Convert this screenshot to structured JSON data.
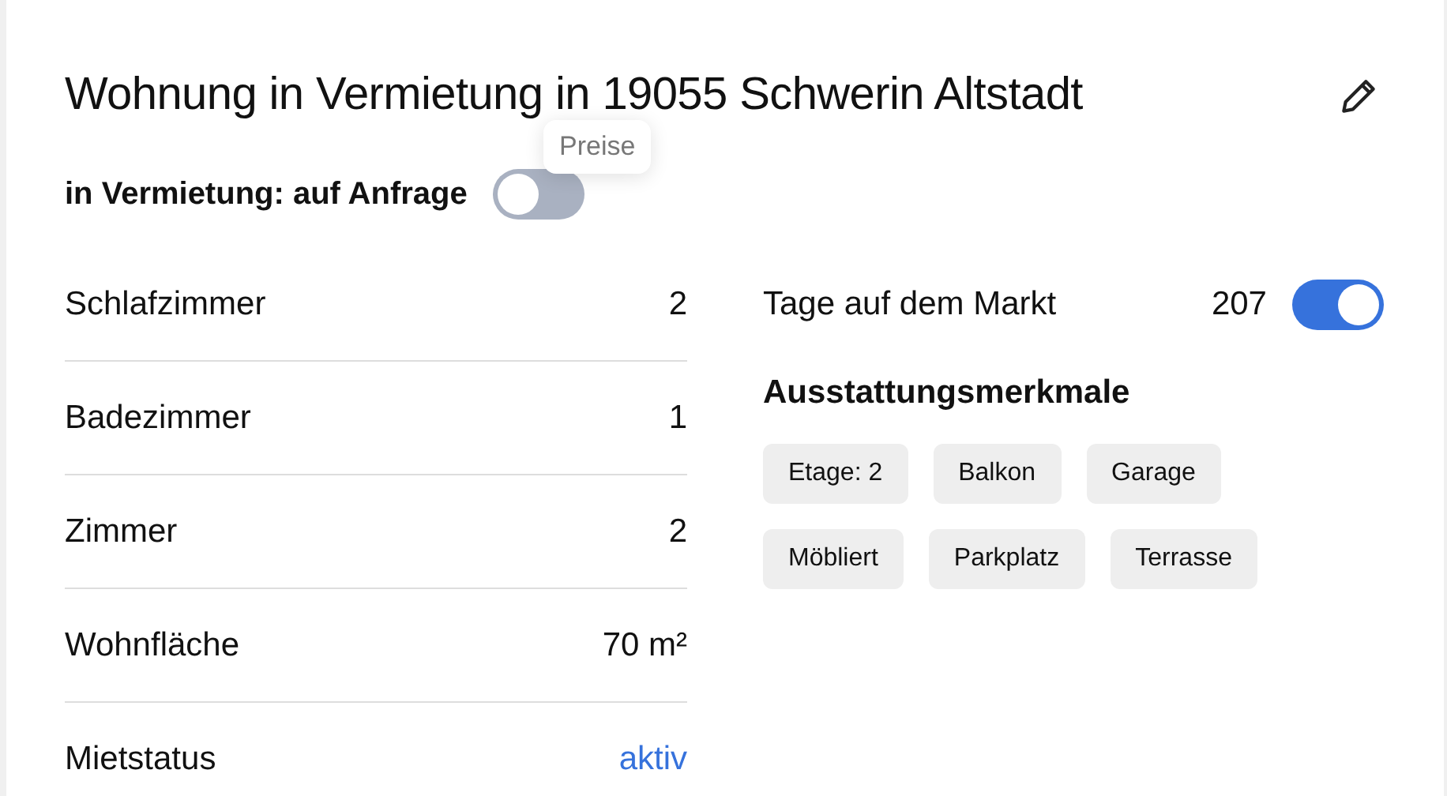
{
  "title": "Wohnung in Vermietung in 19055 Schwerin Altstadt",
  "tooltip": "Preise",
  "rent_toggle": {
    "label": "in Vermietung: auf Anfrage",
    "on": false
  },
  "details": [
    {
      "label": "Schlafzimmer",
      "value": "2",
      "kind": "text"
    },
    {
      "label": "Badezimmer",
      "value": "1",
      "kind": "text"
    },
    {
      "label": "Zimmer",
      "value": "2",
      "kind": "text"
    },
    {
      "label": "Wohnfläche",
      "value": "70 m²",
      "kind": "text"
    },
    {
      "label": "Mietstatus",
      "value": "aktiv",
      "kind": "link"
    }
  ],
  "days_on_market": {
    "label": "Tage auf dem Markt",
    "value": "207",
    "on": true
  },
  "features": {
    "heading": "Ausstattungsmerkmale",
    "tags": [
      "Etage: 2",
      "Balkon",
      "Garage",
      "Möbliert",
      "Parkplatz",
      "Terrasse"
    ]
  }
}
